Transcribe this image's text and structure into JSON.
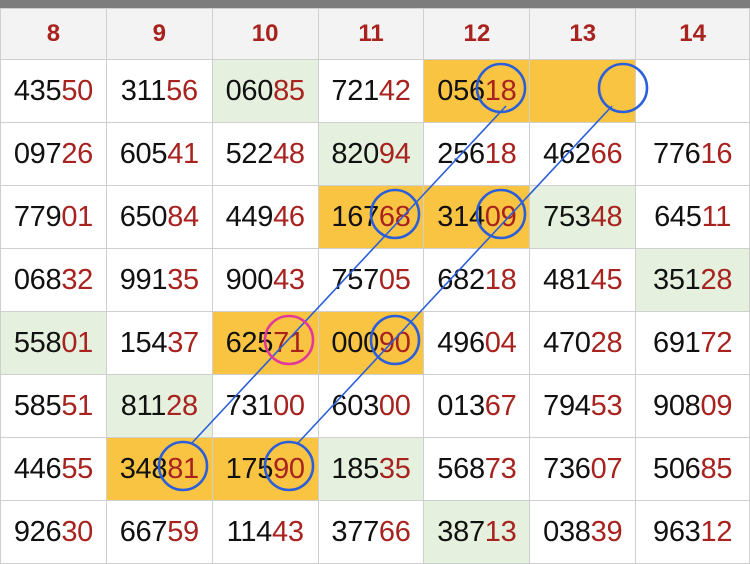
{
  "headers": [
    "8",
    "9",
    "10",
    "11",
    "12",
    "13",
    "14"
  ],
  "rows": [
    [
      {
        "h": "435",
        "t": "50"
      },
      {
        "h": "311",
        "t": "56"
      },
      {
        "h": "060",
        "t": "85",
        "bg": "green"
      },
      {
        "h": "721",
        "t": "42"
      },
      {
        "h": "056",
        "t": "18",
        "bg": "yellow"
      },
      {
        "h": "",
        "t": "",
        "bg": "yellow"
      },
      {
        "h": "",
        "t": ""
      }
    ],
    [
      {
        "h": "097",
        "t": "26"
      },
      {
        "h": "605",
        "t": "41"
      },
      {
        "h": "522",
        "t": "48"
      },
      {
        "h": "820",
        "t": "94",
        "bg": "green"
      },
      {
        "h": "256",
        "t": "18"
      },
      {
        "h": "462",
        "t": "66"
      },
      {
        "h": "776",
        "t": "16"
      }
    ],
    [
      {
        "h": "779",
        "t": "01"
      },
      {
        "h": "650",
        "t": "84"
      },
      {
        "h": "449",
        "t": "46"
      },
      {
        "h": "167",
        "t": "68",
        "bg": "yellow"
      },
      {
        "h": "314",
        "t": "09",
        "bg": "yellow"
      },
      {
        "h": "753",
        "t": "48",
        "bg": "green"
      },
      {
        "h": "645",
        "t": "11"
      }
    ],
    [
      {
        "h": "068",
        "t": "32"
      },
      {
        "h": "991",
        "t": "35"
      },
      {
        "h": "900",
        "t": "43"
      },
      {
        "h": "757",
        "t": "05"
      },
      {
        "h": "682",
        "t": "18"
      },
      {
        "h": "481",
        "t": "45"
      },
      {
        "h": "351",
        "t": "28",
        "bg": "green"
      }
    ],
    [
      {
        "h": "558",
        "t": "01",
        "bg": "green"
      },
      {
        "h": "154",
        "t": "37"
      },
      {
        "h": "625",
        "t": "71",
        "bg": "yellow"
      },
      {
        "h": "000",
        "t": "90",
        "bg": "yellow"
      },
      {
        "h": "496",
        "t": "04"
      },
      {
        "h": "470",
        "t": "28"
      },
      {
        "h": "691",
        "t": "72"
      }
    ],
    [
      {
        "h": "585",
        "t": "51"
      },
      {
        "h": "811",
        "t": "28",
        "bg": "green"
      },
      {
        "h": "731",
        "t": "00"
      },
      {
        "h": "603",
        "t": "00"
      },
      {
        "h": "013",
        "t": "67"
      },
      {
        "h": "794",
        "t": "53"
      },
      {
        "h": "908",
        "t": "09"
      }
    ],
    [
      {
        "h": "446",
        "t": "55"
      },
      {
        "h": "348",
        "t": "81",
        "bg": "yellow"
      },
      {
        "h": "175",
        "t": "90",
        "bg": "yellow"
      },
      {
        "h": "185",
        "t": "35",
        "bg": "green"
      },
      {
        "h": "568",
        "t": "73"
      },
      {
        "h": "736",
        "t": "07"
      },
      {
        "h": "506",
        "t": "85"
      }
    ],
    [
      {
        "h": "926",
        "t": "30"
      },
      {
        "h": "667",
        "t": "59"
      },
      {
        "h": "114",
        "t": "43"
      },
      {
        "h": "377",
        "t": "66"
      },
      {
        "h": "387",
        "t": "13",
        "bg": "green"
      },
      {
        "h": "038",
        "t": "39"
      },
      {
        "h": "963",
        "t": "12"
      }
    ]
  ],
  "colors": {
    "accent_red": "#a8231f",
    "highlight_yellow": "#f9c442",
    "highlight_green": "#e5f1de",
    "circle_blue": "#2b5fd9",
    "circle_pink": "#e0399c"
  },
  "annotations": [
    {
      "name": "circle-r0-c12",
      "row": 0,
      "col": 4,
      "color": "blue"
    },
    {
      "name": "circle-r0-c13",
      "row": 0,
      "col": 5,
      "color": "blue"
    },
    {
      "name": "circle-r2-c11",
      "row": 2,
      "col": 3,
      "color": "blue"
    },
    {
      "name": "circle-r2-c12",
      "row": 2,
      "col": 4,
      "color": "blue"
    },
    {
      "name": "circle-r4-c10",
      "row": 4,
      "col": 2,
      "color": "pink"
    },
    {
      "name": "circle-r4-c11",
      "row": 4,
      "col": 3,
      "color": "blue"
    },
    {
      "name": "circle-r6-c9",
      "row": 6,
      "col": 1,
      "color": "blue"
    },
    {
      "name": "circle-r6-c10",
      "row": 6,
      "col": 2,
      "color": "blue"
    }
  ],
  "connectors": [
    {
      "name": "diagonal-line-a",
      "from": [
        0,
        4
      ],
      "to": [
        6,
        1
      ]
    },
    {
      "name": "diagonal-line-b",
      "from": [
        0,
        5
      ],
      "to": [
        6,
        2
      ]
    }
  ]
}
